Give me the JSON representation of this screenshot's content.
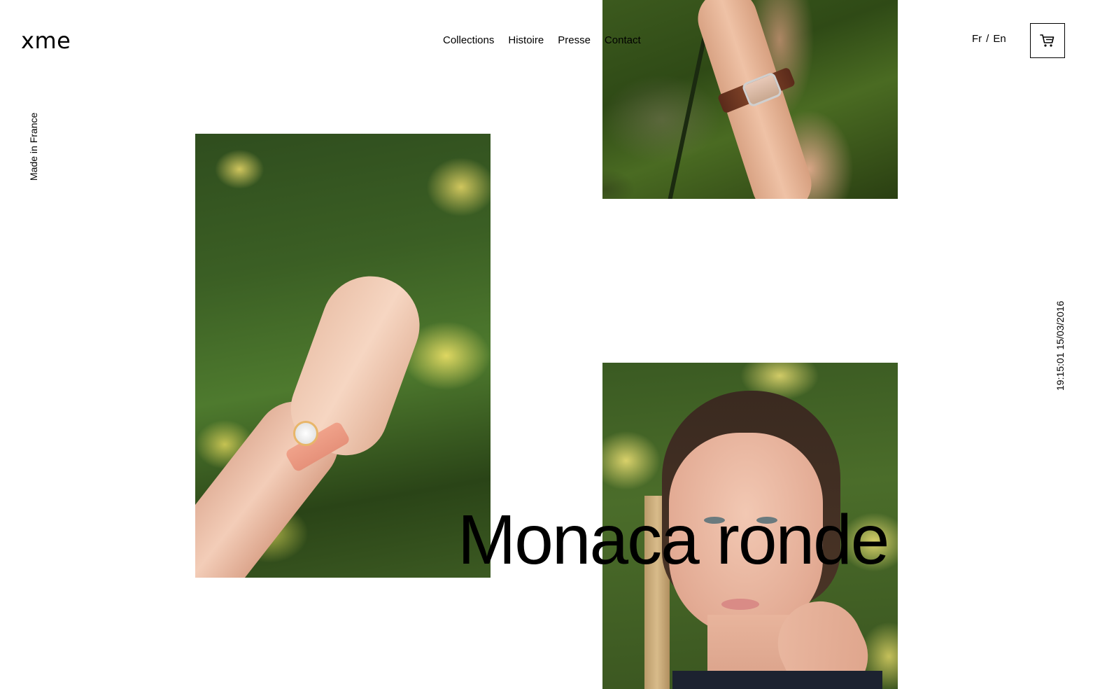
{
  "brand": {
    "logo_text": "xme"
  },
  "nav": {
    "items": [
      {
        "label": "Collections"
      },
      {
        "label": "Histoire"
      },
      {
        "label": "Presse"
      },
      {
        "label": "Contact"
      }
    ]
  },
  "language": {
    "fr": "Fr",
    "separator": "/",
    "en": "En"
  },
  "cart": {
    "icon": "cart-icon"
  },
  "sidebar_left": {
    "text": "Made in France"
  },
  "sidebar_right": {
    "text": "19:15:01 15/03/2016"
  },
  "hero": {
    "title": "Monaca ronde"
  },
  "colors": {
    "text": "#000000",
    "background": "#ffffff",
    "foliage": "#3b5f24",
    "mimosa": "#e3d66e"
  }
}
